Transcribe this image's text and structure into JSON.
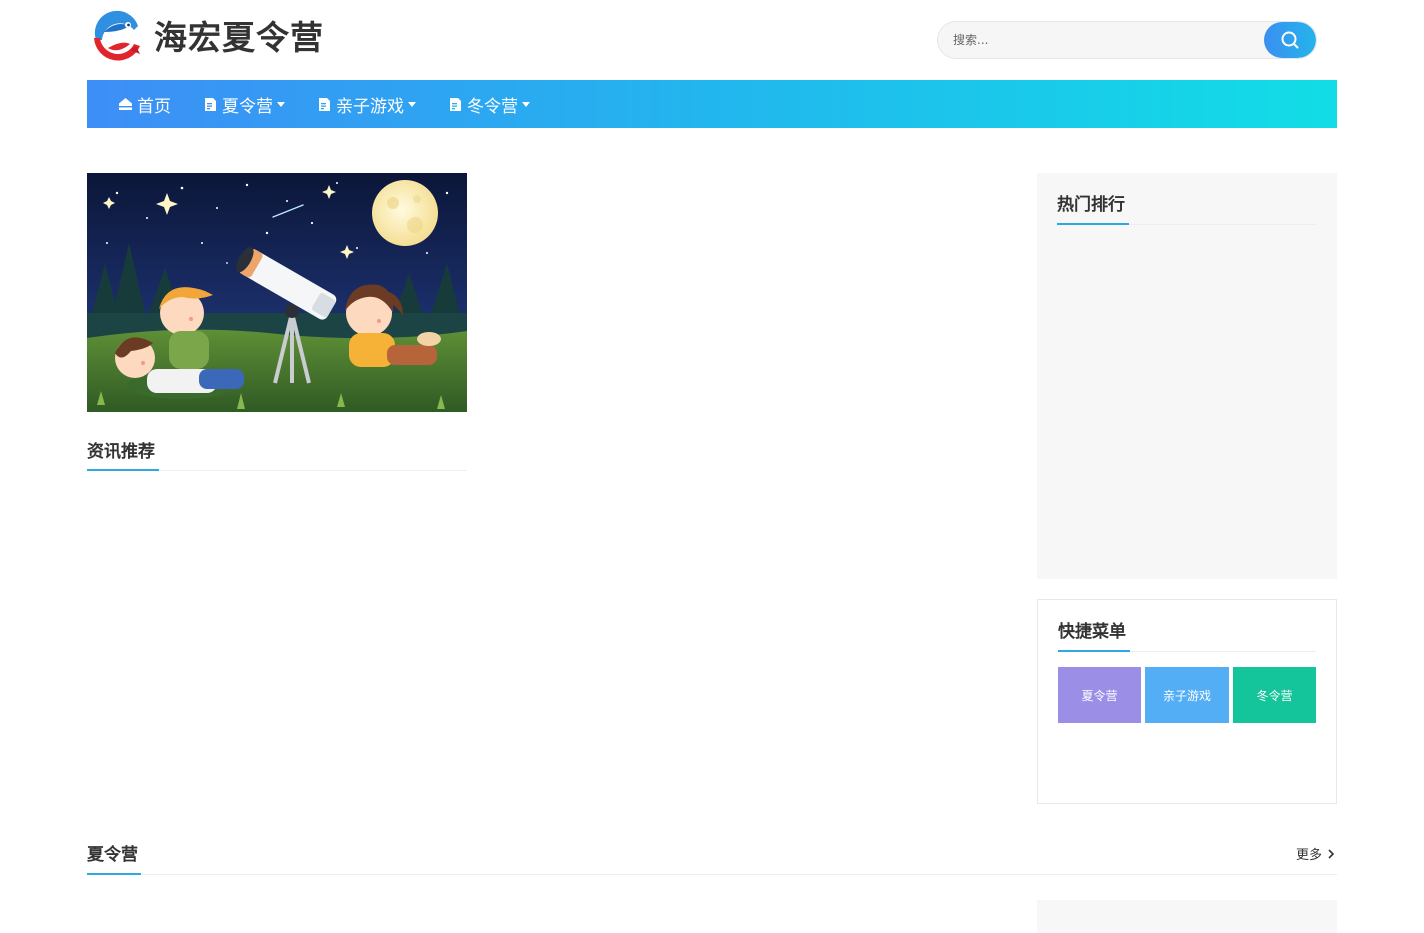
{
  "site": {
    "name": "海宏夏令营"
  },
  "search": {
    "placeholder": "搜索..."
  },
  "nav": {
    "items": [
      {
        "label": "首页",
        "has_dropdown": false
      },
      {
        "label": "夏令营",
        "has_dropdown": true
      },
      {
        "label": "亲子游戏",
        "has_dropdown": true
      },
      {
        "label": "冬令营",
        "has_dropdown": true
      }
    ]
  },
  "main": {
    "recommend_title": "资讯推荐"
  },
  "sidebar": {
    "hot_title": "热门排行",
    "quick_title": "快捷菜单",
    "quick_items": [
      {
        "label": "夏令营",
        "color": "#9b8ee6"
      },
      {
        "label": "亲子游戏",
        "color": "#53aef5"
      },
      {
        "label": "冬令营",
        "color": "#14c49a"
      }
    ]
  },
  "category": {
    "title": "夏令营",
    "more_label": "更多"
  },
  "colors": {
    "accent": "#2fa8e5",
    "nav_start": "#3d8ef6",
    "nav_end": "#12dde6"
  }
}
